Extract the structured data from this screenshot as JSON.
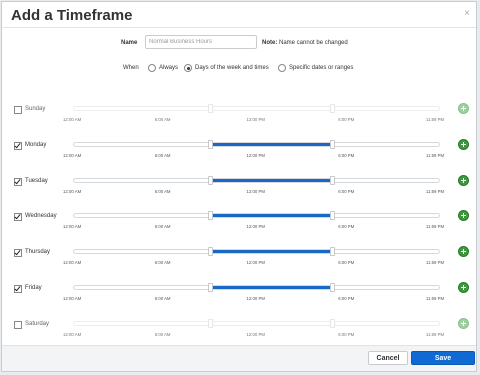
{
  "dialog": {
    "title": "Add a Timeframe",
    "close_glyph": "×"
  },
  "name_field": {
    "label": "Name",
    "value": "Normal Business Hours",
    "note_bold": "Note:",
    "note_text": " Name cannot be changed"
  },
  "when": {
    "label": "When",
    "options": [
      {
        "label": "Always",
        "selected": false
      },
      {
        "label": "Days of the week and times",
        "selected": true
      },
      {
        "label": "Specific dates or ranges",
        "selected": false
      }
    ]
  },
  "tick_labels": [
    "12:00 AM",
    "6:00 AM",
    "12:00 PM",
    "6:00 PM",
    "11:59 PM"
  ],
  "days": [
    {
      "name": "Sunday",
      "checked": false,
      "range_start": 0.375,
      "range_end": 0.708
    },
    {
      "name": "Monday",
      "checked": true,
      "range_start": 0.375,
      "range_end": 0.708
    },
    {
      "name": "Tuesday",
      "checked": true,
      "range_start": 0.375,
      "range_end": 0.708
    },
    {
      "name": "Wednesday",
      "checked": true,
      "range_start": 0.375,
      "range_end": 0.708
    },
    {
      "name": "Thursday",
      "checked": true,
      "range_start": 0.375,
      "range_end": 0.708
    },
    {
      "name": "Friday",
      "checked": true,
      "range_start": 0.375,
      "range_end": 0.708
    },
    {
      "name": "Saturday",
      "checked": false,
      "range_start": 0.375,
      "range_end": 0.708
    }
  ],
  "footer": {
    "cancel_label": "Cancel",
    "save_label": "Save"
  },
  "colors": {
    "accent": "#1169d4",
    "range_fill": "#1a68c5",
    "add_green": "#3c9a3c"
  },
  "icons": {
    "close": "close-icon",
    "add": "plus-circle-icon",
    "check": "checkmark-icon"
  }
}
